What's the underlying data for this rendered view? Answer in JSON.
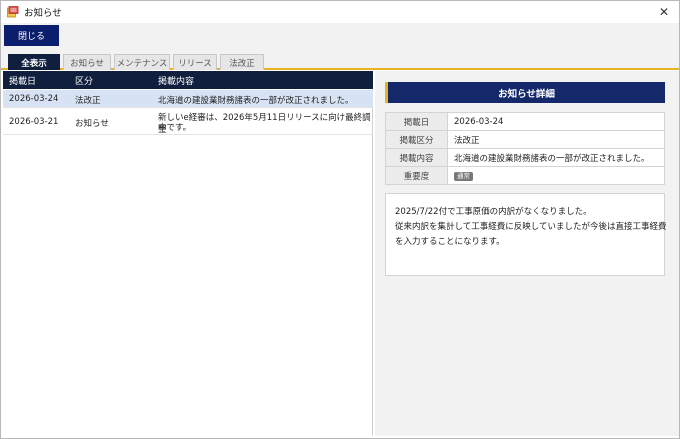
{
  "window": {
    "title": "お知らせ"
  },
  "toolbar": {
    "close_label": "閉じる"
  },
  "tabs": [
    "全表示",
    "お知らせ",
    "メンテナンス",
    "リリース",
    "法改正"
  ],
  "grid": {
    "headers": [
      "掲載日",
      "区分",
      "掲載内容"
    ],
    "rows": [
      {
        "date": "2026-03-24",
        "category": "法改正",
        "content_lines": [
          "北海道の建設業財務諸表の一部が改正されました。"
        ]
      },
      {
        "date": "2026-03-21",
        "category": "お知らせ",
        "content_lines": [
          "新しいe経審は、2026年5月11日リリースに向け最終調整",
          "中です。"
        ]
      }
    ]
  },
  "detail": {
    "header": "お知らせ詳細",
    "labels": {
      "date": "掲載日",
      "category": "掲載区分",
      "content": "掲載内容",
      "importance": "重要度"
    },
    "values": {
      "date": "2026-03-24",
      "category": "法改正",
      "content": "北海道の建設業財務諸表の一部が改正されました。",
      "importance": "通常"
    },
    "body_lines": [
      "2025/7/22付で工事原価の内訳がなくなりました。",
      "従来内訳を集計して工事経費に反映していましたが今後は直接工事経費",
      "を入力することになります。"
    ]
  },
  "colors": {
    "navy": "#0f1f3d",
    "accent": "#e8b227",
    "selected_row": "#d7e3f4",
    "button": "#0b1d6d"
  }
}
